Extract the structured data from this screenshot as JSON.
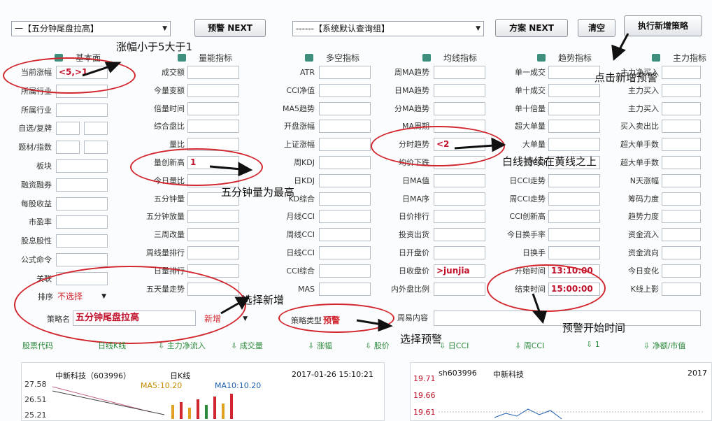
{
  "toolbar": {
    "strategy_select": "一【五分钟尾盘拉高】",
    "warn_next": "预警 NEXT",
    "group_select": "------【系统默认查询组】",
    "plan_next": "方案 NEXT",
    "clear": "清空",
    "execute": "执行新增策略"
  },
  "columns": [
    "基本面",
    "量能指标",
    "多空指标",
    "均线指标",
    "趋势指标",
    "主力指标"
  ],
  "col1": {
    "labels": [
      "当前涨幅",
      "所属行业",
      "所属行业",
      "自选/复牌",
      "题材/指数",
      "板块",
      "融资融券",
      "每股收益",
      "市盈率",
      "股息股性",
      "公式命令",
      "关联"
    ],
    "current_range": "<5,>1"
  },
  "col2": {
    "labels": [
      "成交额",
      "今量变额",
      "倍量时间",
      "综合盘比",
      "量比",
      "量创新高",
      "今日量比",
      "五分钟量",
      "五分钟放量",
      "三周改量",
      "周线量排行",
      "日量排行",
      "五天量走势"
    ],
    "volume_high": "1"
  },
  "col3": {
    "labels": [
      "ATR",
      "CCI净值",
      "MA5趋势",
      "开盘涨幅",
      "上证涨幅",
      "周KDJ",
      "日KDJ",
      "KD综合",
      "月线CCI",
      "周线CCI",
      "日线CCI",
      "CCI综合",
      "MAS"
    ]
  },
  "col4": {
    "labels": [
      "周MA趋势",
      "日MA趋势",
      "分MA趋势",
      "MA周期",
      "分时趋势",
      "均价下跌",
      "日MA值",
      "日MA序",
      "日价排行",
      "投资出货",
      "日开盘价",
      "日收盘价",
      "内外盘比例"
    ],
    "intraday_trend": "<2",
    "close_price": ">junjia"
  },
  "col5": {
    "labels": [
      "单一成交",
      "单十成交",
      "单十倍量",
      "超大单量",
      "大单量",
      "日CCI",
      "日CCI走势",
      "周CCI走势",
      "CCI创新高",
      "今日换手率",
      "日换手",
      "开始时间",
      "结束时间"
    ],
    "start_time": "13:10:00",
    "end_time": "15:00:00"
  },
  "col6": {
    "labels": [
      "主力净买入",
      "主力买入",
      "主力买入",
      "买入卖出比",
      "超大单手数",
      "超大单手数",
      "N天涨幅",
      "筹码力度",
      "趋势力度",
      "资金流入",
      "资金流向",
      "今日变化",
      "K线上影"
    ]
  },
  "bottom_form": {
    "sort_label": "排序",
    "sort_value": "不选择",
    "name_label": "策略名",
    "name_value": "五分钟尾盘拉高",
    "add_button": "新增",
    "type_label": "策略类型",
    "type_value": "预警",
    "weekly_label": "周易内容"
  },
  "annotations": {
    "range_note": "涨幅小于5大于1",
    "add_note": "点击新增预警",
    "volume_note": "五分钟量为最高",
    "line_note": "白线持续在黄线之上",
    "select_new": "选择新增",
    "select_warn": "选择预警",
    "time_note": "预警开始时间"
  },
  "tabs": [
    "股票代码",
    "日线K线",
    "⇩ 主力净流入",
    "⇩ 成交量",
    "⇩ 涨幅",
    "⇩ 股价",
    "⇩ 日CCI",
    "⇩ 周CCI",
    "⇩ 1",
    "⇩ 净额/市值"
  ],
  "chart_left": {
    "stock": "中新科技（603996）",
    "period": "日K线",
    "datetime": "2017-01-26  15:10:21",
    "ma1": "MA5:10.20",
    "ma2": "MA10:10.20",
    "y_ticks": [
      "27.58",
      "26.51",
      "25.21"
    ]
  },
  "chart_right": {
    "code": "sh603996",
    "name": "中新科技",
    "year": "2017",
    "y_ticks": [
      "19.71",
      "19.66",
      "19.61"
    ]
  },
  "colors": {
    "red": "#d2262e",
    "green": "#2b8a3a",
    "price_red": "#c0102a"
  }
}
